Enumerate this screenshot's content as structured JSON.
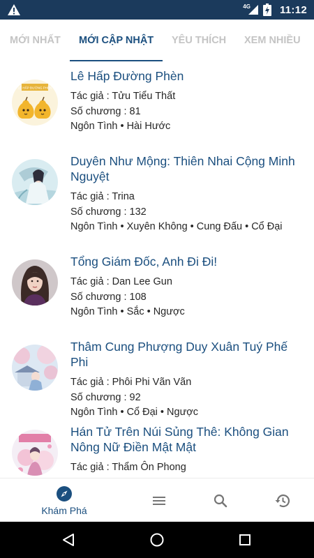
{
  "status_bar": {
    "time": "11:12",
    "network": "4G",
    "icons": [
      "warning-icon",
      "signal-icon",
      "battery-charging-icon"
    ]
  },
  "tabs": [
    {
      "label": "MỚI NHẤT",
      "active": false
    },
    {
      "label": "MỚI CẬP NHẬT",
      "active": true
    },
    {
      "label": "YÊU THÍCH",
      "active": false
    },
    {
      "label": "XEM NHIỀU",
      "active": false
    }
  ],
  "stories": [
    {
      "title": "Lê Hấp Đường Phèn",
      "author": "Tác giả : Tửu Tiểu Thất",
      "chapters": "Số chương : 81",
      "genres": "Ngôn Tình • Hài Hước",
      "cover": "pear-cartoon-cover",
      "cover_text": "LÊ HẤP ĐƯỜNG PHÈN"
    },
    {
      "title": "Duyên Như Mộng: Thiên Nhai Cộng Minh Nguyệt",
      "author": "Tác giả : Trina",
      "chapters": "Số chương : 132",
      "genres": "Ngôn Tình • Xuyên Không • Cung Đấu • Cổ Đại",
      "cover": "ancient-girl-painting-cover"
    },
    {
      "title": "Tổng Giám Đốc, Anh Đi Đi!",
      "author": "Tác giả : Dan Lee Gun",
      "chapters": "Số chương : 108",
      "genres": "Ngôn Tình • Sắc • Ngược",
      "cover": "woman-portrait-cover"
    },
    {
      "title": "Thâm Cung Phượng Duy Xuân Tuý Phế Phi",
      "author": "Tác giả : Phôi Phi Vãn Vãn",
      "chapters": "Số chương : 92",
      "genres": "Ngôn Tình • Cổ Đại • Ngược",
      "cover": "cherry-blossom-palace-cover"
    },
    {
      "title": "Hán Tử Trên Núi Sủng Thê: Không Gian Nông Nữ Điền Mật Mật",
      "author": "Tác giả : Thẩm Ôn Phong",
      "chapters": "",
      "genres": "",
      "cover": "pink-anime-cover"
    }
  ],
  "bottom_nav": [
    {
      "icon": "compass-icon",
      "label": "Khám Phá",
      "active": true
    },
    {
      "icon": "menu-icon",
      "label": "",
      "active": false
    },
    {
      "icon": "search-icon",
      "label": "",
      "active": false
    },
    {
      "icon": "history-icon",
      "label": "",
      "active": false
    }
  ],
  "colors": {
    "status_bar": "#1b3a5c",
    "accent": "#1b4f7f",
    "tab_inactive": "#c4c4c4",
    "text": "#262626"
  }
}
